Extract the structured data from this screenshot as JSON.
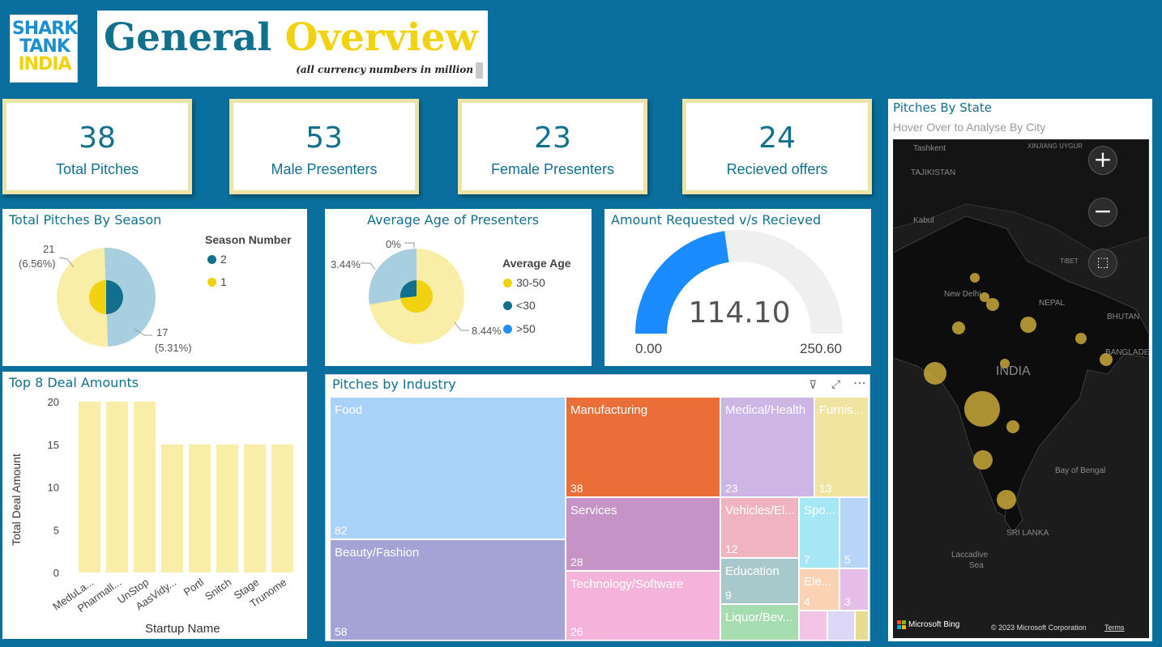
{
  "header": {
    "logo_lines": [
      "SHARK",
      "TANK",
      "INDIA"
    ],
    "title_part1": "General",
    "title_part2": "Overview",
    "subtitle": "(all currency numbers in million"
  },
  "kpis": [
    {
      "value": "38",
      "label": "Total Pitches"
    },
    {
      "value": "53",
      "label": "Male Presenters"
    },
    {
      "value": "23",
      "label": "Female Presenters"
    },
    {
      "value": "24",
      "label": "Recieved offers"
    }
  ],
  "season_chart": {
    "title": "Total Pitches By Season",
    "legend_title": "Season Number",
    "label_21": "21",
    "label_21_pct": "(6.56%)",
    "label_17": "17",
    "label_17_pct": "(5.31%)",
    "legend": [
      {
        "name": "2",
        "color": "#12708f"
      },
      {
        "name": "1",
        "color": "#f1d20e"
      }
    ]
  },
  "age_chart": {
    "title": "Average Age of Presenters",
    "legend_title": "Average Age",
    "label_0": "0%",
    "label_344": "3.44%",
    "label_844": "8.44%",
    "legend": [
      {
        "name": "30-50",
        "color": "#f1d20e"
      },
      {
        "name": "<30",
        "color": "#12708f"
      },
      {
        "name": ">50",
        "color": "#1e90ff"
      }
    ]
  },
  "gauge": {
    "title": "Amount Requested v/s Recieved",
    "value": "114.10",
    "min": "0.00",
    "max": "250.60"
  },
  "deals_chart": {
    "title": "Top 8 Deal Amounts",
    "xlabel": "Startup Name",
    "ylabel": "Total Deal Amount",
    "yticks": [
      "0",
      "5",
      "10",
      "15",
      "20"
    ]
  },
  "industry": {
    "title": "Pitches by Industry",
    "tiles": [
      {
        "name": "Food",
        "value": "82"
      },
      {
        "name": "Beauty/Fashion",
        "value": "58"
      },
      {
        "name": "Manufacturing",
        "value": "38"
      },
      {
        "name": "Services",
        "value": "28"
      },
      {
        "name": "Technology/Software",
        "value": "26"
      },
      {
        "name": "Medical/Health",
        "value": "23"
      },
      {
        "name": "Furnis...",
        "value": "13"
      },
      {
        "name": "Vehicles/El...",
        "value": "12"
      },
      {
        "name": "Education",
        "value": "9"
      },
      {
        "name": "Liquor/Bev...",
        "value": ""
      },
      {
        "name": "Spo...",
        "value": "7"
      },
      {
        "name": "",
        "value": "5"
      },
      {
        "name": "Ele...",
        "value": "4"
      },
      {
        "name": "",
        "value": "3"
      }
    ]
  },
  "map": {
    "title": "Pitches By State",
    "subtitle": "Hover Over to Analyse By City",
    "labels": [
      "Tashkent",
      "TAJIKISTAN",
      "XINJIANG UYGUR",
      "Kabul",
      "TIBET",
      "New Delhi",
      "NEPAL",
      "BHUTAN",
      "BANGLADESH",
      "INDIA",
      "Bay of Bengal",
      "SRI LANKA",
      "Laccadive",
      "Sea"
    ],
    "bing": "Microsoft Bing",
    "copyright": "© 2023 Microsoft Corporation",
    "terms": "Terms"
  },
  "chart_data": [
    {
      "type": "pie",
      "title": "Total Pitches By Season",
      "legend_title": "Season Number",
      "categories": [
        "2",
        "1"
      ],
      "values": [
        17,
        21
      ],
      "labels": [
        "17 (5.31%)",
        "21 (6.56%)"
      ],
      "colors": [
        "#a7cfe0",
        "#f8eea8"
      ]
    },
    {
      "type": "pie",
      "title": "Average Age of Presenters",
      "legend_title": "Average Age",
      "categories": [
        "30-50",
        "<30",
        ">50"
      ],
      "labels": [
        "8.44%",
        "3.44%",
        "0%"
      ],
      "colors": [
        "#f8eea8",
        "#a7cfe0",
        "#1e90ff"
      ]
    },
    {
      "type": "bar",
      "title": "Top 8 Deal Amounts",
      "categories": [
        "MeduLa...",
        "Pharmall...",
        "UnStop",
        "AasVidy...",
        "Portl",
        "Snitch",
        "Stage",
        "Trunome"
      ],
      "values": [
        20,
        20,
        20,
        15,
        15,
        15,
        15,
        15
      ],
      "xlabel": "Startup Name",
      "ylabel": "Total Deal Amount",
      "ylim": [
        0,
        20
      ],
      "color": "#f8eea8"
    },
    {
      "type": "bar",
      "title": "Amount Requested v/s Recieved",
      "values": [
        114.1
      ],
      "ylim": [
        0,
        250.6
      ]
    }
  ]
}
